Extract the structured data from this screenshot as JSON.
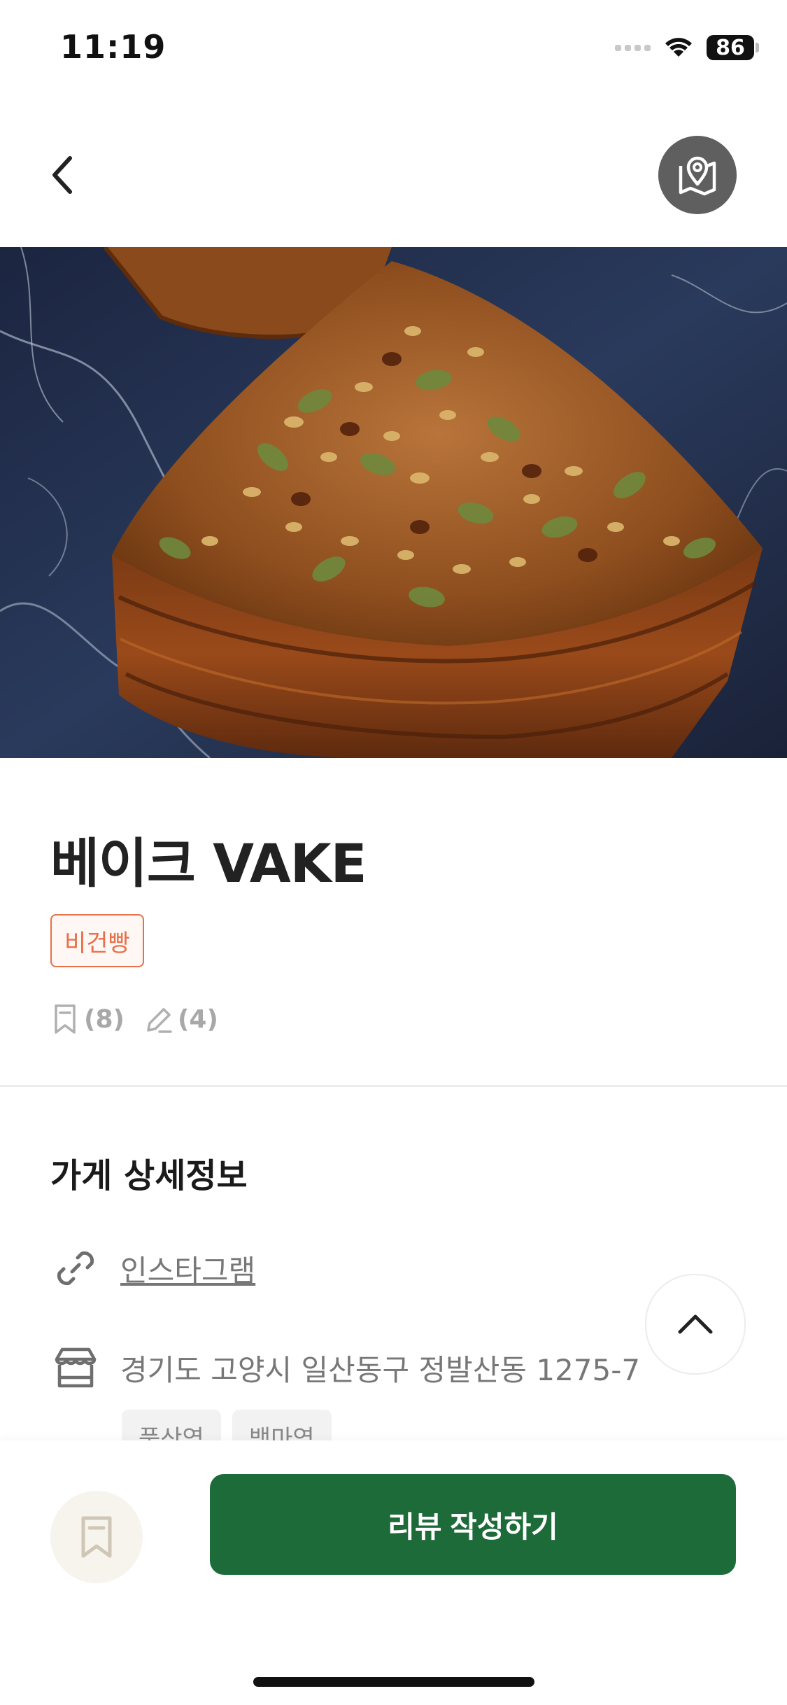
{
  "status_bar": {
    "time": "11:19",
    "battery": "86"
  },
  "store": {
    "name": "베이크 VAKE",
    "category": "비건빵",
    "bookmark_count": "(8)",
    "review_count": "(4)"
  },
  "details": {
    "section_title": "가게 상세정보",
    "instagram_label": "인스타그램",
    "address": "경기도 고양시 일산동구 정발산동 1275-7",
    "stations": [
      "풍산역",
      "백마역"
    ]
  },
  "actions": {
    "write_review_label": "리뷰 작성하기"
  },
  "colors": {
    "accent_green": "#1e6b3a",
    "tag_orange": "#e8704a",
    "map_button_gray": "#5f5f5f"
  },
  "icons": {
    "back": "chevron-left-icon",
    "map": "map-pin-icon",
    "bookmark": "bookmark-icon",
    "pencil": "pencil-icon",
    "link": "link-icon",
    "store": "store-icon",
    "scroll_top": "chevron-up-icon"
  }
}
